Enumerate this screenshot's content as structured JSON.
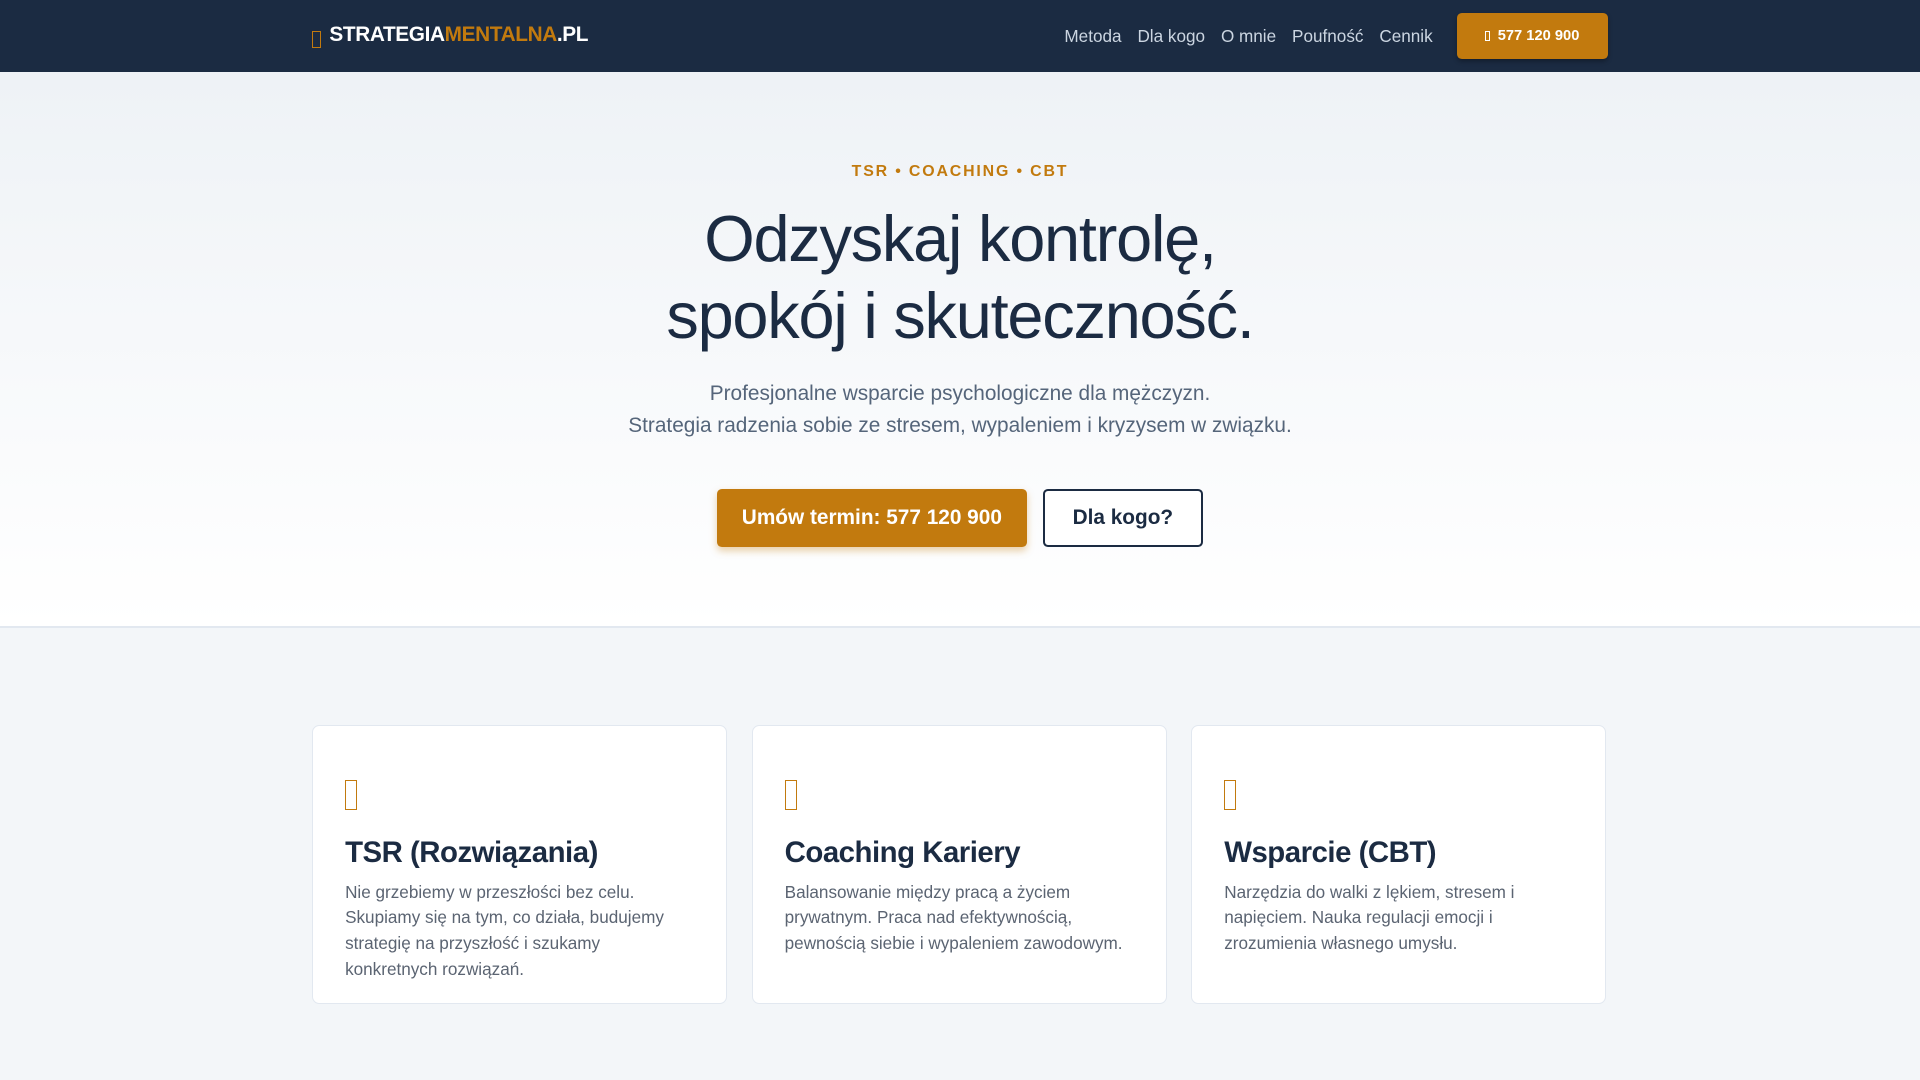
{
  "nav": {
    "logo": {
      "icon": "brain-icon",
      "part1": "STRATEGIA",
      "part2": "MENTALNA",
      "part3": ".PL"
    },
    "items": [
      "Metoda",
      "Dla kogo",
      "O mnie",
      "Poufność",
      "Cennik"
    ],
    "phone_button": {
      "icon": "phone-icon",
      "label": "577 120 900"
    }
  },
  "hero": {
    "kicker": "TSR • COACHING • CBT",
    "title_line1": "Odzyskaj kontrolę,",
    "title_line2": "spokój i skuteczność.",
    "sub_line1": "Profesjonalne wsparcie psychologiczne dla mężczyzn.",
    "sub_line2": "Strategia radzenia sobie ze stresem, wypaleniem i kryzysem w związku.",
    "primary_button": "Umów termin: 577 120 900",
    "secondary_button": "Dla kogo?"
  },
  "cards": [
    {
      "icon": "solution-icon",
      "title": "TSR (Rozwiązania)",
      "text": "Nie grzebiemy w przeszłości bez celu. Skupiamy się na tym, co działa, budujemy strategię na przyszłość i szukamy konkretnych rozwiązań."
    },
    {
      "icon": "career-icon",
      "title": "Coaching Kariery",
      "text": "Balansowanie między pracą a życiem prywatnym. Praca nad efektywnością, pewnością siebie i wypaleniem zawodowym."
    },
    {
      "icon": "support-icon",
      "title": "Wsparcie (CBT)",
      "text": "Narzędzia do walki z lękiem, stresem i napięciem. Nauka regulacji emocji i zrozumienia własnego umysłu."
    }
  ],
  "colors": {
    "navy": "#1b2b42",
    "accent": "#c27a0e"
  }
}
